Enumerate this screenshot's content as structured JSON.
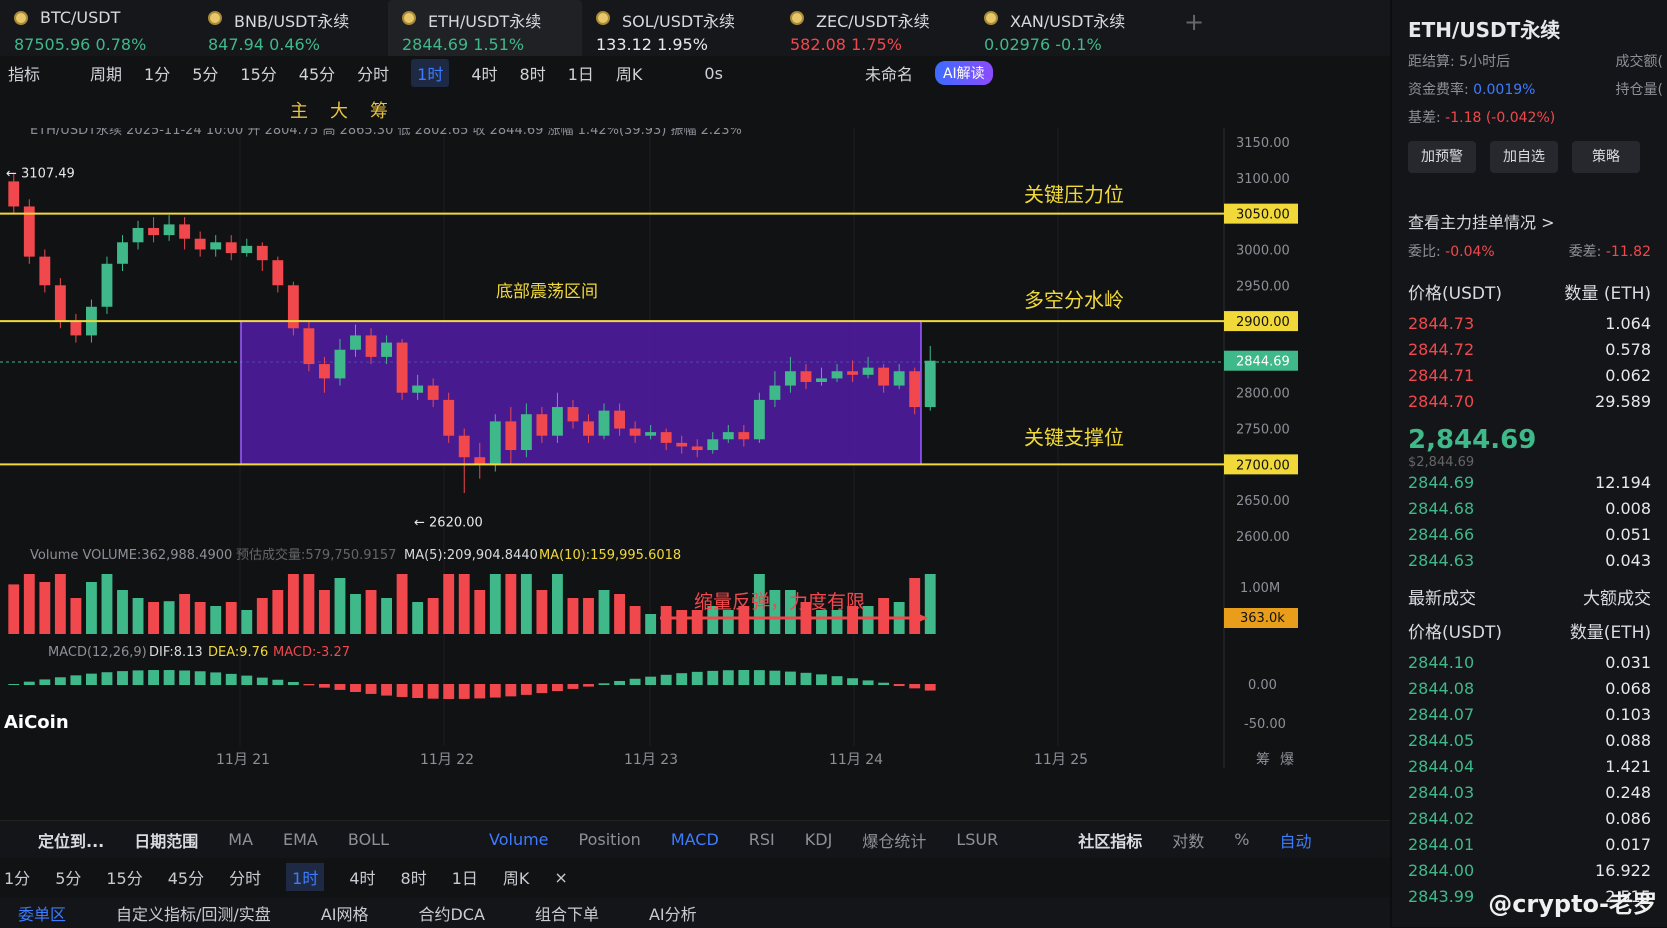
{
  "tabs": [
    {
      "name": "BTC/USDT",
      "price": "87505.96",
      "change": "0.78%",
      "dir": "up"
    },
    {
      "name": "BNB/USDT永续",
      "price": "847.94",
      "change": "0.46%",
      "dir": "up"
    },
    {
      "name": "ETH/USDT永续",
      "price": "2844.69",
      "change": "1.51%",
      "dir": "up"
    },
    {
      "name": "SOL/USDT永续",
      "price": "133.12",
      "change": "1.95%",
      "dir": "up"
    },
    {
      "name": "ZEC/USDT永续",
      "price": "582.08",
      "change": "1.75%",
      "dir": "dn"
    },
    {
      "name": "XAN/USDT永续",
      "price": "0.02976",
      "change": "-0.1%",
      "dir": "up"
    }
  ],
  "toolbar": {
    "indicator": "指标",
    "period": "周期",
    "intervals": [
      "1分",
      "5分",
      "15分",
      "45分",
      "分时",
      "1时",
      "4时",
      "8时",
      "1日",
      "周K"
    ],
    "selected": "1时",
    "timer": "0s",
    "unnamed": "未命名",
    "ai": "AI解读"
  },
  "drawbar": [
    "主",
    "大",
    "筹"
  ],
  "ohlc": "ETH/USDT永续  2025-11-24 10:00  开 2804.75  高 2865.30  低 2802.65  收 2844.69  涨幅 1.42%(39.93)  振幅 2.23%",
  "annotations": {
    "resistance": "关键压力位",
    "watershed": "多空分水岭",
    "range": "底部震荡区间",
    "support": "关键支撑位",
    "volume_note": "缩量反弹，力度有限",
    "high_mark": "← 3107.49",
    "low_mark": "← 2620.00"
  },
  "price_axis": [
    "3150.00",
    "3100.00",
    "3050.00",
    "3000.00",
    "2950.00",
    "2900.00",
    "2844.69",
    "2800.00",
    "2750.00",
    "2700.00",
    "2650.00",
    "2600.00"
  ],
  "date_axis": [
    "11月 21",
    "11月 22",
    "11月 23",
    "11月 24",
    "11月 25"
  ],
  "volume": {
    "label": "Volume  VOLUME:362,988.4900",
    "pred": "预估成交量:579,750.9157",
    "ma5": "MA(5):209,904.8440",
    "ma10": "MA(10):159,995.6018",
    "axis": "1.00M",
    "current": "363.0k"
  },
  "macd": {
    "label": "MACD(12,26,9)",
    "dif": "DIF:8.13",
    "dea": "DEA:9.76",
    "macd": "MACD:-3.27",
    "axis0": "0.00",
    "axis1": "-50.00"
  },
  "logo": "AiCoin",
  "corner": [
    "筹",
    "爆"
  ],
  "bottom_indicators": [
    "定位到...",
    "日期范围",
    "MA",
    "EMA",
    "BOLL",
    "Volume",
    "Position",
    "MACD",
    "RSI",
    "KDJ",
    "爆仓统计",
    "LSUR",
    "社区指标",
    "对数",
    "%",
    "自动"
  ],
  "tf2": [
    "1分",
    "5分",
    "15分",
    "45分",
    "分时",
    "1时",
    "4时",
    "8时",
    "1日",
    "周K",
    "×"
  ],
  "bottom_tabs": [
    "委单区",
    "自定义指标/回测/实盘",
    "AI网格",
    "合约DCA",
    "组合下单",
    "AI分析"
  ],
  "chart_data": {
    "type": "candlestick",
    "levels": [
      3050,
      2900,
      2700
    ],
    "box": {
      "low": 2700,
      "high": 2900
    },
    "ylim": [
      2600,
      3150
    ],
    "candles": [
      [
        3095,
        3060,
        3107,
        3050
      ],
      [
        3060,
        2990,
        3070,
        2980
      ],
      [
        2990,
        2950,
        3000,
        2940
      ],
      [
        2950,
        2900,
        2960,
        2890
      ],
      [
        2900,
        2880,
        2910,
        2870
      ],
      [
        2880,
        2920,
        2930,
        2870
      ],
      [
        2920,
        2980,
        2990,
        2910
      ],
      [
        2980,
        3010,
        3020,
        2970
      ],
      [
        3010,
        3030,
        3040,
        3000
      ],
      [
        3030,
        3020,
        3045,
        3010
      ],
      [
        3020,
        3035,
        3048,
        3012
      ],
      [
        3035,
        3015,
        3045,
        3000
      ],
      [
        3015,
        3000,
        3025,
        2990
      ],
      [
        3000,
        3010,
        3020,
        2990
      ],
      [
        3010,
        2995,
        3020,
        2985
      ],
      [
        2995,
        3005,
        3015,
        2990
      ],
      [
        3005,
        2985,
        3010,
        2970
      ],
      [
        2985,
        2950,
        2990,
        2940
      ],
      [
        2950,
        2890,
        2955,
        2880
      ],
      [
        2890,
        2840,
        2900,
        2830
      ],
      [
        2840,
        2820,
        2850,
        2800
      ],
      [
        2820,
        2860,
        2875,
        2810
      ],
      [
        2860,
        2880,
        2895,
        2850
      ],
      [
        2880,
        2850,
        2890,
        2840
      ],
      [
        2850,
        2870,
        2880,
        2840
      ],
      [
        2870,
        2800,
        2875,
        2790
      ],
      [
        2800,
        2810,
        2825,
        2790
      ],
      [
        2810,
        2790,
        2820,
        2780
      ],
      [
        2790,
        2740,
        2800,
        2730
      ],
      [
        2740,
        2710,
        2750,
        2660
      ],
      [
        2710,
        2700,
        2730,
        2680
      ],
      [
        2700,
        2760,
        2770,
        2690
      ],
      [
        2760,
        2720,
        2780,
        2700
      ],
      [
        2720,
        2770,
        2785,
        2710
      ],
      [
        2770,
        2740,
        2780,
        2730
      ],
      [
        2740,
        2780,
        2800,
        2730
      ],
      [
        2780,
        2760,
        2790,
        2750
      ],
      [
        2760,
        2740,
        2770,
        2730
      ],
      [
        2740,
        2775,
        2785,
        2735
      ],
      [
        2775,
        2750,
        2785,
        2740
      ],
      [
        2750,
        2740,
        2760,
        2730
      ],
      [
        2740,
        2745,
        2755,
        2735
      ],
      [
        2745,
        2730,
        2750,
        2720
      ],
      [
        2730,
        2725,
        2740,
        2715
      ],
      [
        2725,
        2720,
        2735,
        2710
      ],
      [
        2720,
        2735,
        2745,
        2715
      ],
      [
        2735,
        2745,
        2755,
        2730
      ],
      [
        2745,
        2735,
        2755,
        2725
      ],
      [
        2735,
        2790,
        2800,
        2730
      ],
      [
        2790,
        2810,
        2830,
        2780
      ],
      [
        2810,
        2830,
        2850,
        2800
      ],
      [
        2830,
        2815,
        2840,
        2805
      ],
      [
        2815,
        2820,
        2835,
        2810
      ],
      [
        2820,
        2830,
        2840,
        2815
      ],
      [
        2830,
        2825,
        2845,
        2815
      ],
      [
        2825,
        2835,
        2850,
        2820
      ],
      [
        2835,
        2810,
        2840,
        2800
      ],
      [
        2810,
        2830,
        2840,
        2805
      ],
      [
        2830,
        2780,
        2835,
        2770
      ],
      [
        2780,
        2844.69,
        2865.3,
        2775
      ]
    ]
  }
}
